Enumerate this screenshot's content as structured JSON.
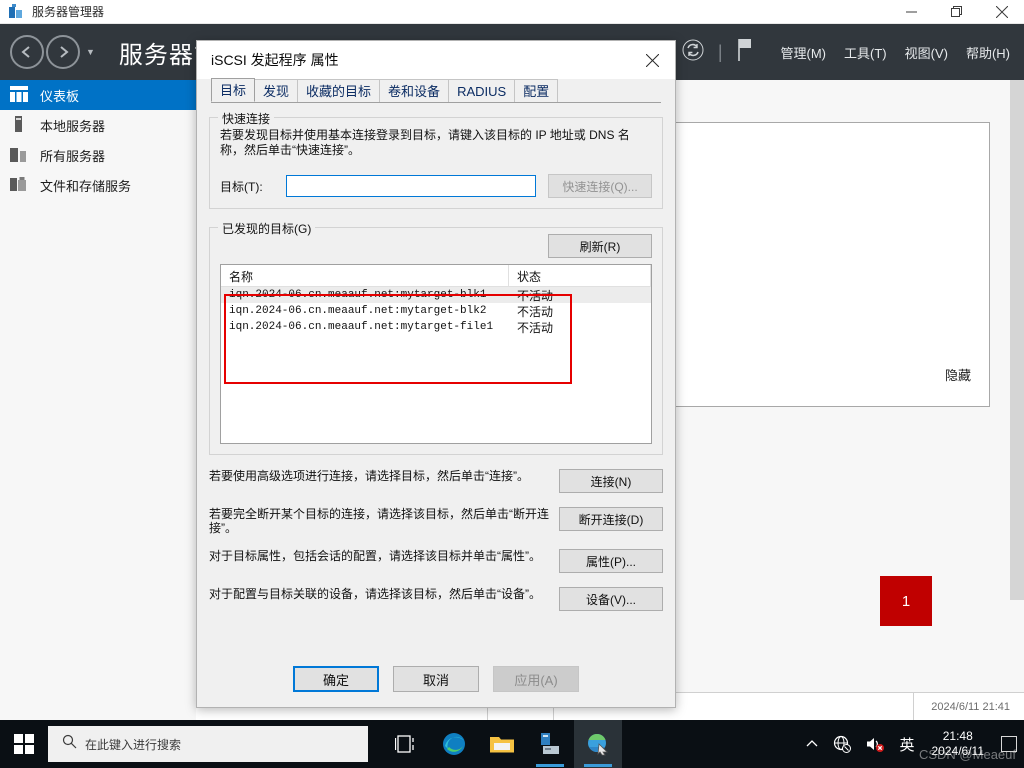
{
  "server_manager": {
    "window_title": "服务器管理器",
    "title_icon": "server-manager-icon",
    "window_buttons": {
      "minimize": "minimize-icon",
      "restore": "restore-icon",
      "close": "close-icon"
    },
    "breadcrumb": "服务器管理器",
    "header_icons": {
      "refresh": "refresh-icon",
      "separator": "|",
      "flag": "notifications-flag-icon"
    },
    "menus": [
      "管理(M)",
      "工具(T)",
      "视图(V)",
      "帮助(H)"
    ],
    "sidebar": [
      {
        "label": "仪表板",
        "icon": "dashboard-icon",
        "active": true
      },
      {
        "label": "本地服务器",
        "icon": "local-server-icon",
        "active": false
      },
      {
        "label": "所有服务器",
        "icon": "all-servers-icon",
        "active": false
      },
      {
        "label": "文件和存储服务",
        "icon": "file-storage-icon",
        "active": false
      }
    ],
    "content": {
      "hide_link": "隐藏",
      "tile_count": "1",
      "status_date": "2024/6/11 21:41"
    }
  },
  "dialog": {
    "title": "iSCSI 发起程序 属性",
    "close_icon": "close-icon",
    "tabs": [
      {
        "label": "目标",
        "active": true
      },
      {
        "label": "发现",
        "active": false
      },
      {
        "label": "收藏的目标",
        "active": false
      },
      {
        "label": "卷和设备",
        "active": false
      },
      {
        "label": "RADIUS",
        "active": false
      },
      {
        "label": "配置",
        "active": false
      }
    ],
    "quick_connect": {
      "legend": "快速连接",
      "description": "若要发现目标并使用基本连接登录到目标，请键入该目标的 IP 地址或 DNS 名称，然后单击“快速连接”。",
      "target_label": "目标(T):",
      "target_value": "",
      "target_placeholder": "",
      "quick_connect_button": "快速连接(Q)..."
    },
    "discovered": {
      "legend": "已发现的目标(G)",
      "refresh_button": "刷新(R)",
      "columns": [
        "名称",
        "状态"
      ],
      "rows": [
        {
          "name": "iqn.2024-06.cn.meaauf.net:mytarget-blk1",
          "state": "不活动"
        },
        {
          "name": "iqn.2024-06.cn.meaauf.net:mytarget-blk2",
          "state": "不活动"
        },
        {
          "name": "iqn.2024-06.cn.meaauf.net:mytarget-file1",
          "state": "不活动"
        }
      ],
      "highlight_color": "#e60000"
    },
    "actions": [
      {
        "desc": "若要使用高级选项进行连接，请选择目标，然后单击“连接”。",
        "button": "连接(N)"
      },
      {
        "desc": "若要完全断开某个目标的连接，请选择该目标，然后单击“断开连接”。",
        "button": "断开连接(D)"
      },
      {
        "desc": "对于目标属性，包括会话的配置，请选择该目标并单击“属性”。",
        "button": "属性(P)..."
      },
      {
        "desc": "对于配置与目标关联的设备，请选择该目标，然后单击“设备”。",
        "button": "设备(V)..."
      }
    ],
    "footer": {
      "ok": "确定",
      "cancel": "取消",
      "apply": "应用(A)"
    }
  },
  "taskbar": {
    "start_icon": "windows-start-icon",
    "search_placeholder": "在此键入进行搜索",
    "search_icon": "search-icon",
    "buttons": [
      {
        "name": "task-view-icon"
      },
      {
        "name": "edge-icon"
      },
      {
        "name": "file-explorer-icon"
      },
      {
        "name": "server-manager-taskbar-icon"
      },
      {
        "name": "iscsi-initiator-icon"
      }
    ],
    "tray": {
      "chevron": "show-hidden-icons-chevron",
      "network": "network-offline-icon",
      "volume": "volume-muted-icon",
      "ime": "英"
    },
    "clock_time": "21:48",
    "clock_date": "2024/6/11",
    "watermark": "CSDN @Meaeuf"
  }
}
